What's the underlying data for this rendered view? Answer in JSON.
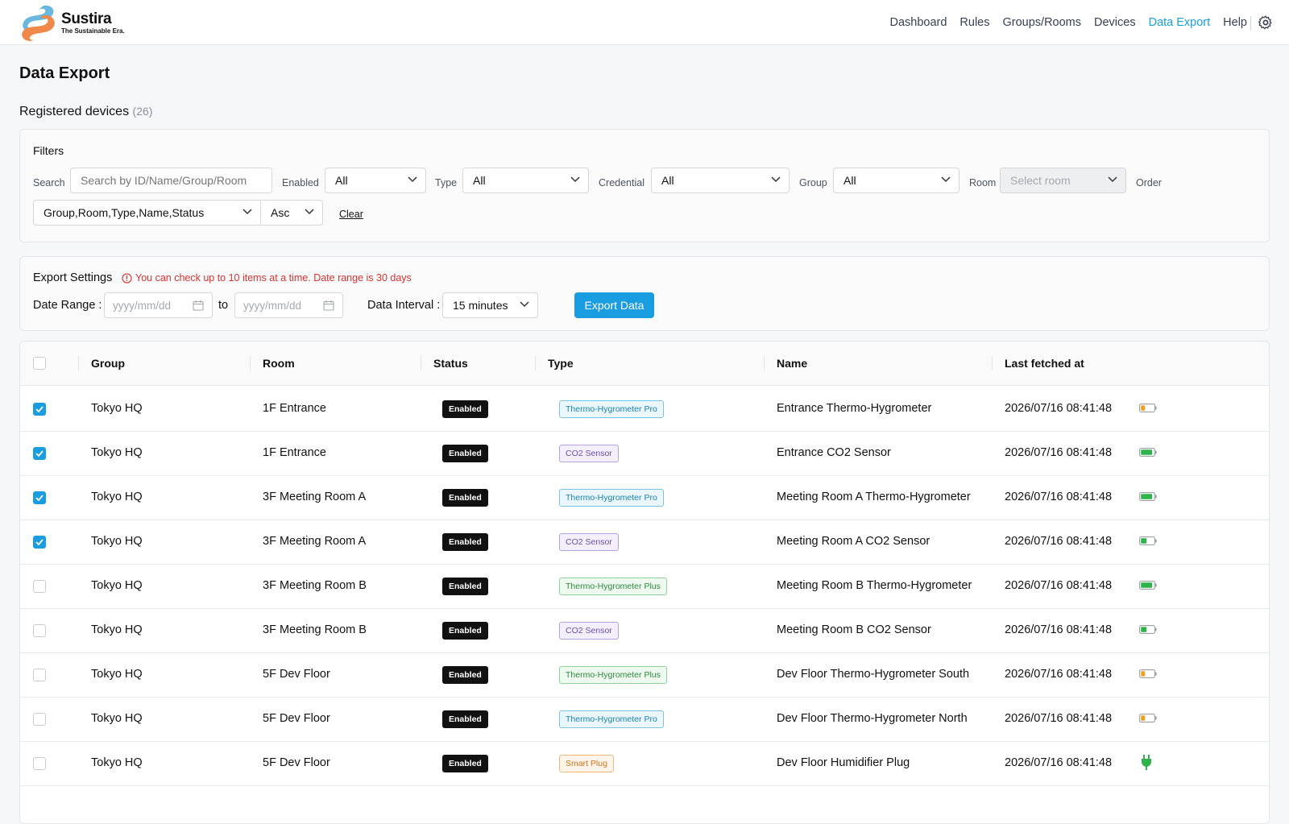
{
  "brand": {
    "name": "Sustira",
    "tagline": "The Sustainable Era.",
    "colors": {
      "blue": "#6ab8e0",
      "orange": "#f0884a"
    }
  },
  "nav": {
    "items": [
      "Dashboard",
      "Rules",
      "Groups/Rooms",
      "Devices",
      "Data Export",
      "Help"
    ],
    "active": "Data Export",
    "settings_icon": "gear-icon"
  },
  "page": {
    "title": "Data Export",
    "registered_label": "Registered devices",
    "registered_count": "(26)"
  },
  "filters": {
    "title": "Filters",
    "search_label": "Search",
    "search_placeholder": "Search by ID/Name/Group/Room",
    "enabled_label": "Enabled",
    "enabled_value": "All",
    "type_label": "Type",
    "type_value": "All",
    "credential_label": "Credential",
    "credential_value": "All",
    "group_label": "Group",
    "group_value": "All",
    "room_label": "Room",
    "room_placeholder": "Select room",
    "order_label": "Order",
    "order_value": "Group,Room,Type,Name,Status",
    "direction_value": "Asc",
    "clear_label": "Clear"
  },
  "export": {
    "title": "Export Settings",
    "warning": "You can check up to 10 items at a time. Date range is 30 days",
    "date_range_label": "Date Range",
    "date_from_placeholder": "yyyy/mm/dd",
    "to_label": "to",
    "date_to_placeholder": "yyyy/mm/dd",
    "interval_label": "Data Interval",
    "interval_value": "15 minutes",
    "button_label": "Export Data"
  },
  "table": {
    "columns": [
      "Group",
      "Room",
      "Status",
      "Type",
      "Name",
      "Last fetched at"
    ],
    "rows": [
      {
        "checked": true,
        "group": "Tokyo HQ",
        "room": "1F Entrance",
        "status": "Enabled",
        "type": "Thermo-Hygrometer Pro",
        "name": "Entrance Thermo-Hygrometer",
        "last": "2026/07/16 08:41:48",
        "power": "battery-low"
      },
      {
        "checked": true,
        "group": "Tokyo HQ",
        "room": "1F Entrance",
        "status": "Enabled",
        "type": "CO2 Sensor",
        "name": "Entrance CO2 Sensor",
        "last": "2026/07/16 08:41:48",
        "power": "battery-full"
      },
      {
        "checked": true,
        "group": "Tokyo HQ",
        "room": "3F Meeting Room A",
        "status": "Enabled",
        "type": "Thermo-Hygrometer Pro",
        "name": "Meeting Room A Thermo-Hygrometer",
        "last": "2026/07/16 08:41:48",
        "power": "battery-full"
      },
      {
        "checked": true,
        "group": "Tokyo HQ",
        "room": "3F Meeting Room A",
        "status": "Enabled",
        "type": "CO2 Sensor",
        "name": "Meeting Room A CO2 Sensor",
        "last": "2026/07/16 08:41:48",
        "power": "battery-half"
      },
      {
        "checked": false,
        "group": "Tokyo HQ",
        "room": "3F Meeting Room B",
        "status": "Enabled",
        "type": "Thermo-Hygrometer Plus",
        "name": "Meeting Room B Thermo-Hygrometer",
        "last": "2026/07/16 08:41:48",
        "power": "battery-full"
      },
      {
        "checked": false,
        "group": "Tokyo HQ",
        "room": "3F Meeting Room B",
        "status": "Enabled",
        "type": "CO2 Sensor",
        "name": "Meeting Room B CO2 Sensor",
        "last": "2026/07/16 08:41:48",
        "power": "battery-half"
      },
      {
        "checked": false,
        "group": "Tokyo HQ",
        "room": "5F Dev Floor",
        "status": "Enabled",
        "type": "Thermo-Hygrometer Plus",
        "name": "Dev Floor Thermo-Hygrometer South",
        "last": "2026/07/16 08:41:48",
        "power": "battery-low"
      },
      {
        "checked": false,
        "group": "Tokyo HQ",
        "room": "5F Dev Floor",
        "status": "Enabled",
        "type": "Thermo-Hygrometer Pro",
        "name": "Dev Floor Thermo-Hygrometer North",
        "last": "2026/07/16 08:41:48",
        "power": "battery-low"
      },
      {
        "checked": false,
        "group": "Tokyo HQ",
        "room": "5F Dev Floor",
        "status": "Enabled",
        "type": "Smart Plug",
        "name": "Dev Floor Humidifier Plug",
        "last": "2026/07/16 08:41:48",
        "power": "plug"
      }
    ]
  },
  "type_colors": {
    "Thermo-Hygrometer Pro": {
      "fg": "#1a84b8",
      "bg": "#eaf6fc",
      "border": "#7cc4e6"
    },
    "CO2 Sensor": {
      "fg": "#6b4fb8",
      "bg": "#f3effc",
      "border": "#b3a1e3"
    },
    "Thermo-Hygrometer Plus": {
      "fg": "#2e8b3e",
      "bg": "#eef9ef",
      "border": "#8fd19a"
    },
    "Smart Plug": {
      "fg": "#d9731a",
      "bg": "#fff5ea",
      "border": "#f2b57a"
    }
  },
  "power_colors": {
    "battery-full": "#2fb34a",
    "battery-half": "#2fb34a",
    "battery-low": "#f0a020",
    "plug": "#2fb34a"
  }
}
